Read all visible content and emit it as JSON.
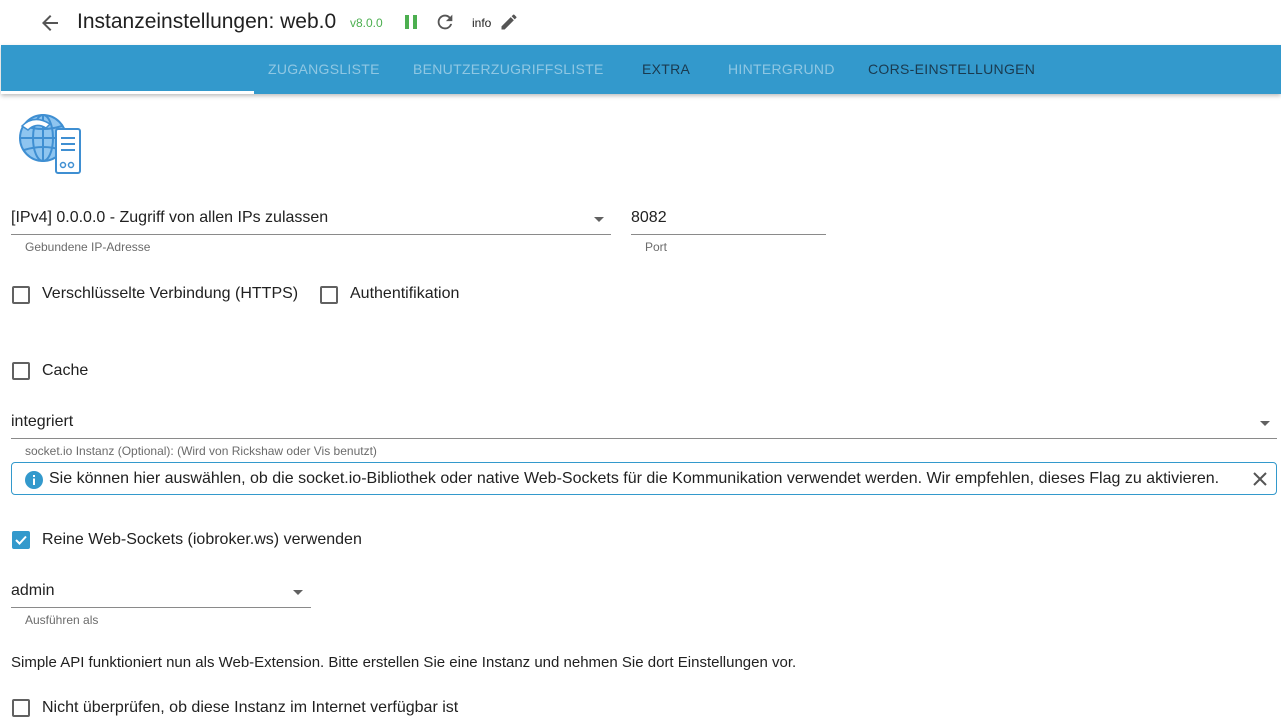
{
  "header": {
    "title": "Instanzeinstellungen: web.0",
    "version": "v8.0.0",
    "loglevel": "info",
    "icons": [
      "arrow-back-icon",
      "pause-icon",
      "reload-icon",
      "edit-icon"
    ],
    "version_color": "#4caf50"
  },
  "tabs": [
    {
      "label": "Zugangsliste",
      "active": true
    },
    {
      "label": "Benutzerzugriffsliste",
      "active": false
    },
    {
      "label": "Extra",
      "active": false
    },
    {
      "label": "Hintergrund",
      "active": false
    },
    {
      "label": "CORS-Einstellungen",
      "active": false
    }
  ],
  "theme": {
    "primary": "#3399cc",
    "accent": "#3399cc"
  },
  "form": {
    "bind": {
      "value": "[IPv4] 0.0.0.0 - Zugriff von allen IPs zulassen",
      "label": "Gebundene IP-Adresse"
    },
    "port": {
      "value": "8082",
      "label": "Port"
    },
    "secure": {
      "label": "Verschlüsselte Verbindung (HTTPS)",
      "checked": false
    },
    "auth": {
      "label": "Authentifikation",
      "checked": false
    },
    "cache": {
      "label": "Cache",
      "checked": false
    },
    "socketio": {
      "value": "integriert",
      "label": "socket.io Instanz (Optional): (Wird von Rickshaw oder Vis benutzt)"
    },
    "info": {
      "text": "Sie können hier auswählen, ob die socket.io-Bibliothek oder native Web-Sockets für die Kommunikation verwendet werden. Wir empfehlen, dieses Flag zu aktivieren."
    },
    "websockets": {
      "label": "Reine Web-Sockets (iobroker.ws) verwenden",
      "checked": true
    },
    "run_as": {
      "value": "admin",
      "label": "Ausführen als"
    },
    "simple_api_note": "Simple API funktioniert nun als Web-Extension. Bitte erstellen Sie eine Instanz und nehmen Sie dort Einstellungen vor.",
    "no_check": {
      "label": "Nicht überprüfen, ob diese Instanz im Internet verfügbar ist",
      "checked": false
    }
  }
}
